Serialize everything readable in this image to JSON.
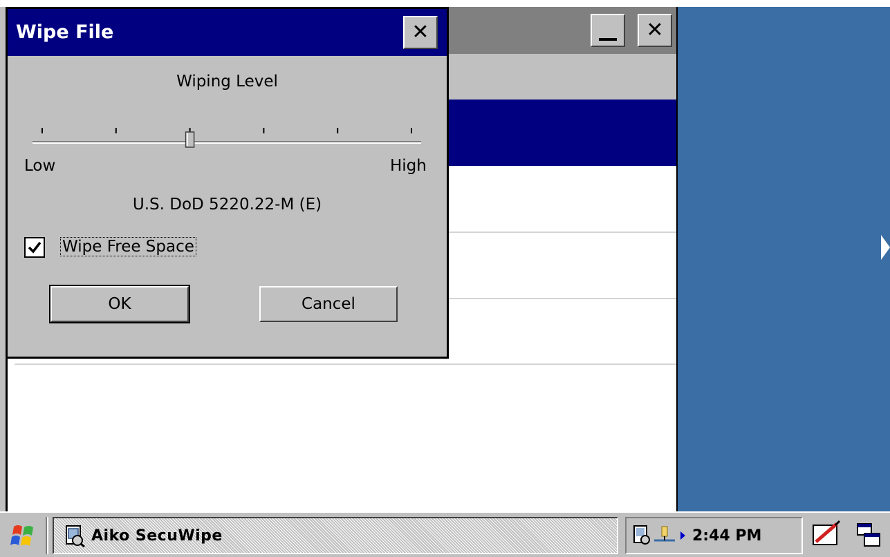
{
  "dialog": {
    "title": "Wipe File",
    "wiping_level_label": "Wiping Level",
    "slider": {
      "min_label": "Low",
      "max_label": "High",
      "tick_count": 6,
      "position_index": 2
    },
    "method_label": "U.S. DoD 5220.22-M (E)",
    "wipe_free_space": {
      "label": "Wipe Free Space",
      "checked": true
    },
    "ok_label": "OK",
    "cancel_label": "Cancel",
    "close_glyph": "✕"
  },
  "main_window": {
    "minimize_icon": "minimize-icon",
    "close_glyph": "✕"
  },
  "taskbar": {
    "task_label": "Aiko SecuWipe",
    "clock": "2:44 PM"
  },
  "colors": {
    "titlebar_active": "#000080",
    "titlebar_inactive": "#808080",
    "desktop": "#3a6ea5",
    "face": "#c0c0c0"
  }
}
